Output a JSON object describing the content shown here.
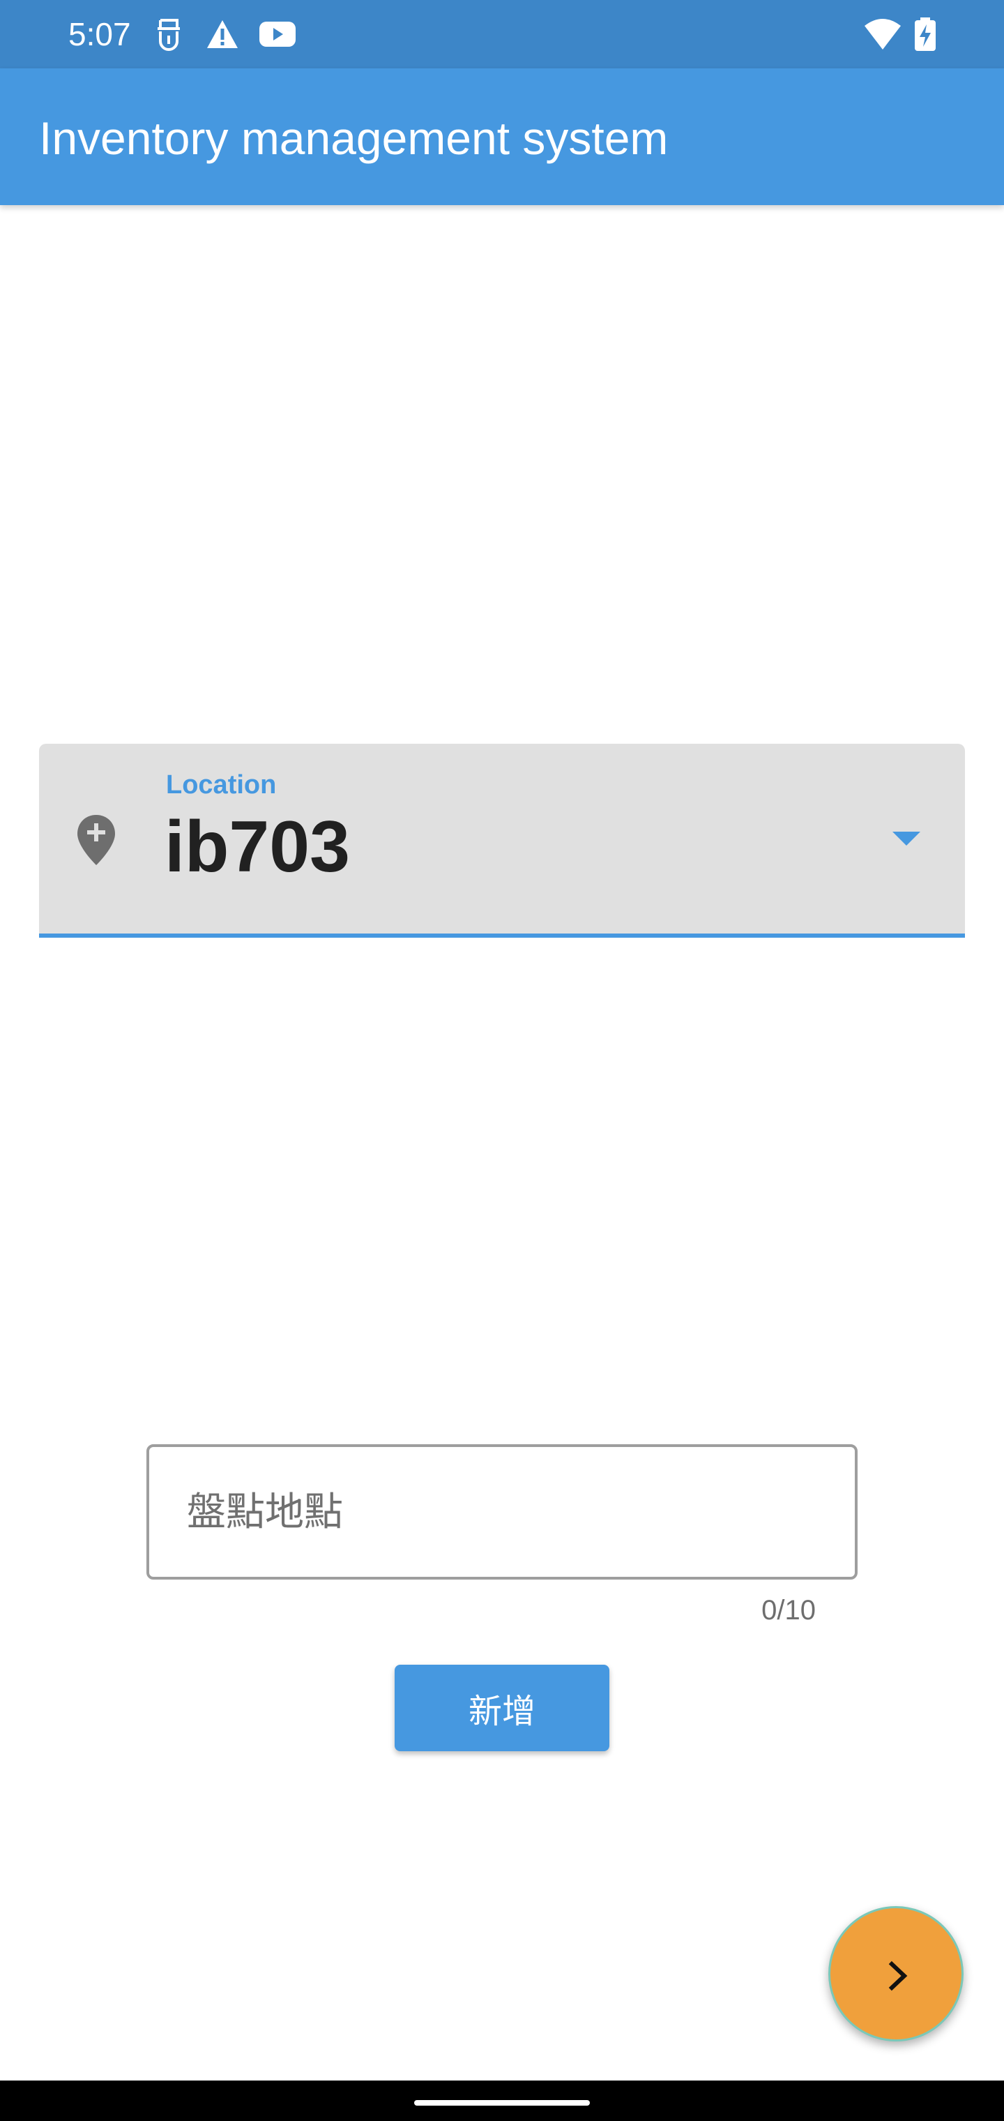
{
  "status_bar": {
    "time": "5:07",
    "icons": [
      "face-id-icon",
      "warning-icon",
      "youtube-icon",
      "wifi-icon",
      "battery-charging-icon"
    ]
  },
  "app_bar": {
    "title": "Inventory management system",
    "color": "#4698e0"
  },
  "location_dropdown": {
    "label": "Location",
    "value": "ib703",
    "icon": "add-location-icon",
    "arrow_icon": "arrow-drop-down-icon"
  },
  "place_input": {
    "placeholder": "盤點地點",
    "value": "",
    "counter": "0/10"
  },
  "add_button": {
    "label": "新增"
  },
  "fab": {
    "icon": "chevron-right-icon",
    "color": "#f0a03c"
  },
  "colors": {
    "primary": "#4698e0",
    "status_bar": "#3d86c8",
    "accent": "#f0a03c"
  }
}
